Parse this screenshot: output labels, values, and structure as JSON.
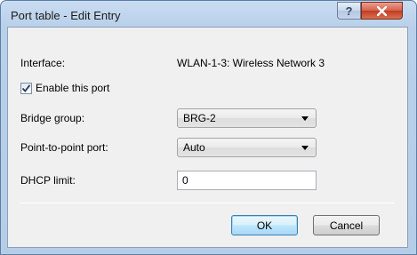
{
  "window": {
    "title": "Port table - Edit Entry",
    "help_symbol": "?"
  },
  "form": {
    "interface_label": "Interface:",
    "interface_value": "WLAN-1-3: Wireless Network 3",
    "enable_label": "Enable this port",
    "enable_checked": true,
    "bridge_group_label": "Bridge group:",
    "bridge_group_value": "BRG-2",
    "p2p_label": "Point-to-point port:",
    "p2p_value": "Auto",
    "dhcp_limit_label": "DHCP limit:",
    "dhcp_limit_value": "0"
  },
  "buttons": {
    "ok": "OK",
    "cancel": "Cancel"
  }
}
